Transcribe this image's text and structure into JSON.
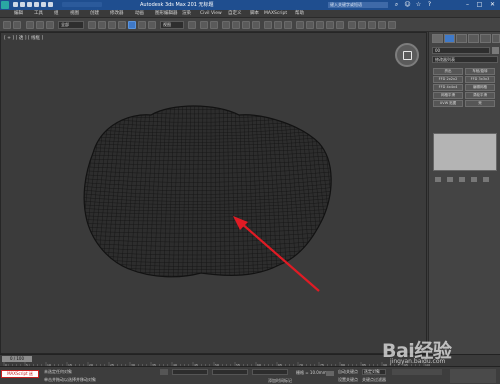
{
  "window": {
    "title": "Autodesk 3ds Max 201  无标题",
    "search_placeholder": "键入关键字或短语"
  },
  "menu": [
    "编辑",
    "工具",
    "组",
    "视图",
    "创建",
    "修改器",
    "动画",
    "图形编辑器",
    "渲染",
    "Civil View",
    "自定义",
    "脚本",
    "MAXScript",
    "帮助"
  ],
  "toolbar": {
    "filter_label": "全部",
    "refsys_label": "视图"
  },
  "viewport": {
    "label": "[ + ] [ 透 ] [ 线框 ]"
  },
  "command_panel": {
    "object_label": "00",
    "modifier_list": "修改器列表",
    "buttons": [
      "挤出",
      "车削/旋转",
      "FFD 2x2x2",
      "FFD 3x3x3",
      "FFD 4x4x4",
      "编辑网格",
      "网格平滑",
      "涡轮平滑",
      "UVW 贴图",
      "壳"
    ]
  },
  "timeline": {
    "frame_label": "0 / 100",
    "ticks": [
      "0",
      "5",
      "10",
      "15",
      "20",
      "25",
      "30",
      "35",
      "40",
      "45",
      "50",
      "55",
      "60",
      "65",
      "70",
      "75",
      "80",
      "85",
      "90",
      "95",
      "100"
    ]
  },
  "statusbar": {
    "selection": "未选定任何对象",
    "prompt": "单击并拖动以选择并移动对象",
    "script_label": "MAXScript 迷",
    "grid_label": "栅格 = 10.0mm",
    "autokey_label": "自动关键点",
    "setkey_label": "设置关键点",
    "selected_dd": "选定对象",
    "filter_label": "关键点过滤器",
    "add_time_tag": "添加时间标记"
  },
  "watermark": {
    "logo": "Bai经验",
    "url": "jingyan.baidu.com"
  },
  "colors": {
    "title_bar": "#1f4e8f",
    "viewport_bg": "#3b3b3b",
    "mesh": "#141414",
    "arrow": "#e01b24",
    "selection_red": "#c92121"
  }
}
